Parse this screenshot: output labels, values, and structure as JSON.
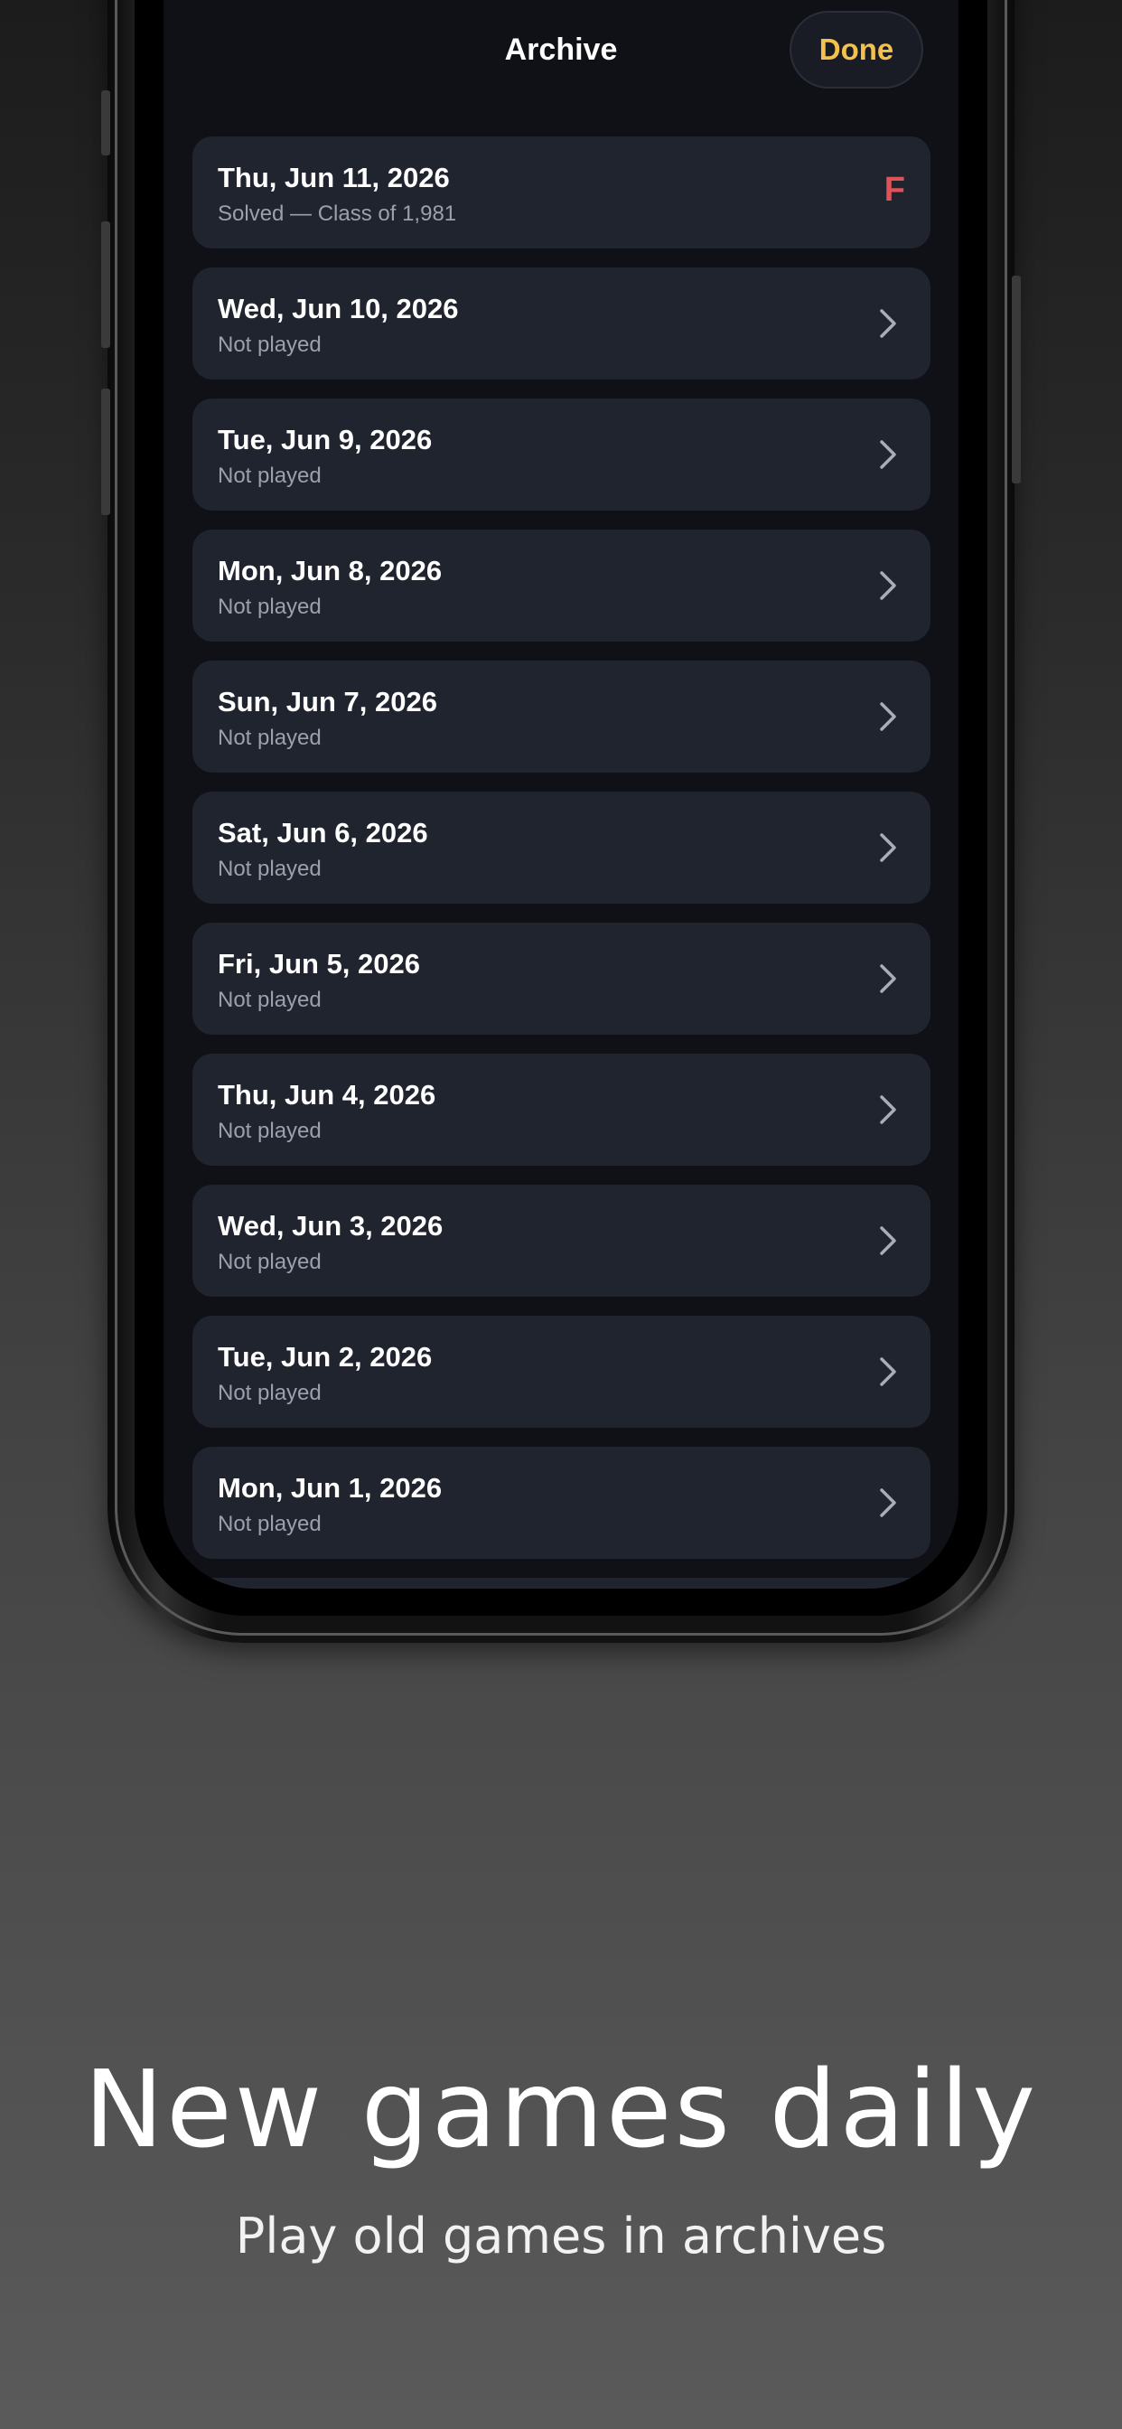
{
  "nav": {
    "title": "Archive",
    "done_label": "Done",
    "done_color": "#f2c14e"
  },
  "archive": {
    "items": [
      {
        "date": "Thu, Jun 11, 2026",
        "status": "Solved — Class of 1,981",
        "grade": "F",
        "grade_color": "#e0525a"
      },
      {
        "date": "Wed, Jun 10, 2026",
        "status": "Not played",
        "icon": "chevron-right-icon"
      },
      {
        "date": "Tue, Jun 9, 2026",
        "status": "Not played",
        "icon": "chevron-right-icon"
      },
      {
        "date": "Mon, Jun 8, 2026",
        "status": "Not played",
        "icon": "chevron-right-icon"
      },
      {
        "date": "Sun, Jun 7, 2026",
        "status": "Not played",
        "icon": "chevron-right-icon"
      },
      {
        "date": "Sat, Jun 6, 2026",
        "status": "Not played",
        "icon": "chevron-right-icon"
      },
      {
        "date": "Fri, Jun 5, 2026",
        "status": "Not played",
        "icon": "chevron-right-icon"
      },
      {
        "date": "Thu, Jun 4, 2026",
        "status": "Not played",
        "icon": "chevron-right-icon"
      },
      {
        "date": "Wed, Jun 3, 2026",
        "status": "Not played",
        "icon": "chevron-right-icon"
      },
      {
        "date": "Tue, Jun 2, 2026",
        "status": "Not played",
        "icon": "chevron-right-icon"
      },
      {
        "date": "Mon, Jun 1, 2026",
        "status": "Not played",
        "icon": "chevron-right-icon"
      }
    ]
  },
  "promo": {
    "headline": "New games daily",
    "subline": "Play old games in archives"
  }
}
